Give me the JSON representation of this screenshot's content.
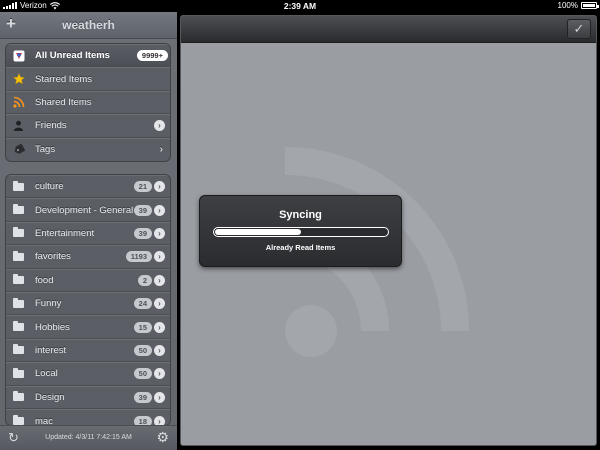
{
  "status_bar": {
    "carrier": "Verizon",
    "time": "2:39 AM",
    "battery": "100%"
  },
  "sidebar": {
    "add_label": "+",
    "title": "weatherh",
    "top_items": [
      {
        "label": "All Unread Items",
        "badge": "9999+",
        "icon": "google-reader-icon"
      },
      {
        "label": "Starred Items",
        "icon": "star-icon"
      },
      {
        "label": "Shared Items",
        "icon": "shared-rss-icon"
      },
      {
        "label": "Friends",
        "icon": "person-icon"
      },
      {
        "label": "Tags",
        "icon": "tag-icon"
      }
    ],
    "folders": [
      {
        "label": "culture",
        "count": "21"
      },
      {
        "label": "Development - General",
        "count": "39"
      },
      {
        "label": "Entertainment",
        "count": "39"
      },
      {
        "label": "favorites",
        "count": "1193"
      },
      {
        "label": "food",
        "count": "2"
      },
      {
        "label": "Funny",
        "count": "24"
      },
      {
        "label": "Hobbies",
        "count": "15"
      },
      {
        "label": "interest",
        "count": "50"
      },
      {
        "label": "Local",
        "count": "50"
      },
      {
        "label": "Design",
        "count": "39"
      },
      {
        "label": "mac",
        "count": "18"
      }
    ],
    "footer": {
      "updated": "Updated: 4/3/11 7:42:15 AM"
    }
  },
  "dialog": {
    "title": "Syncing",
    "subtitle": "Already Read Items",
    "progress": 0.5
  },
  "colors": {
    "sidebar_bg": "#6c7076",
    "main_bg": "#9a9ea3",
    "dialog_bg": "#2b2c2f"
  }
}
